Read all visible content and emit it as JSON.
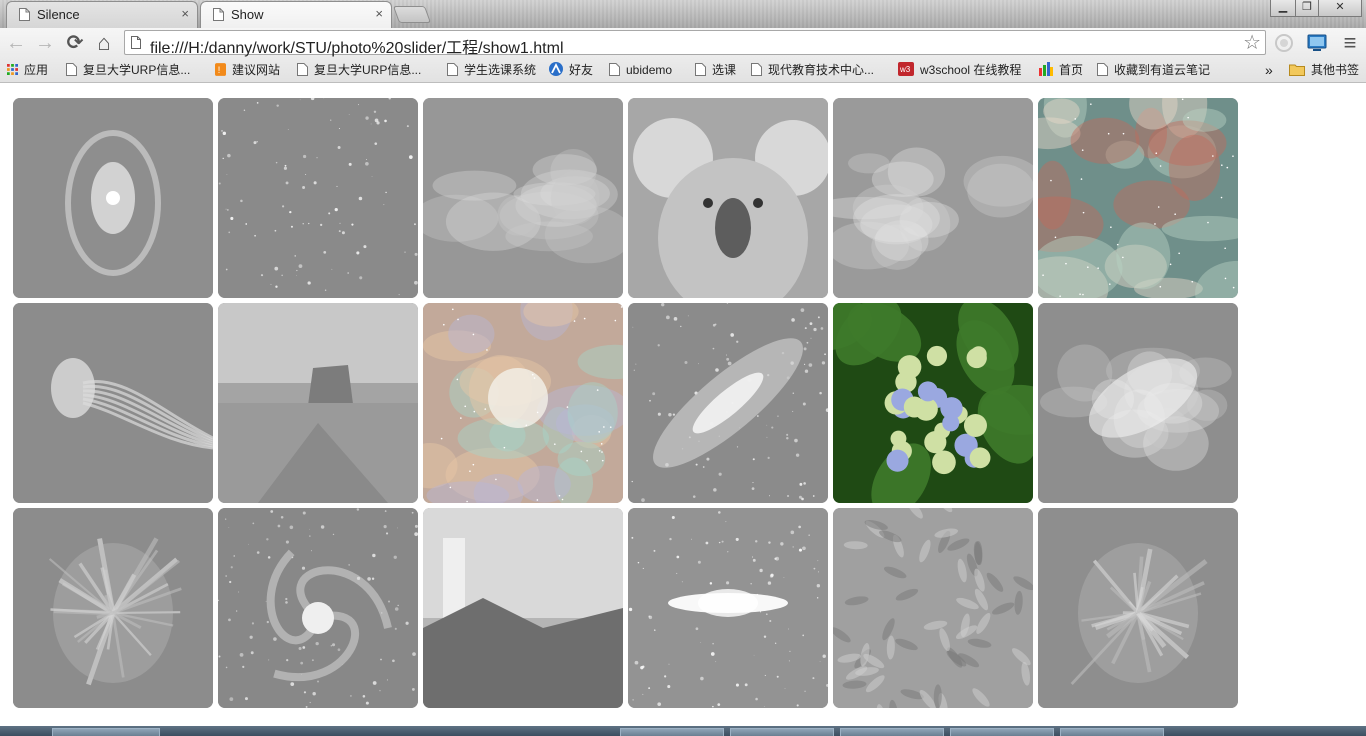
{
  "tabs": [
    {
      "title": "Silence",
      "close": "×",
      "active": false
    },
    {
      "title": "Show",
      "close": "×",
      "active": true
    }
  ],
  "window_controls": {
    "minimize": "▁",
    "restore": "❐",
    "close": "✕"
  },
  "toolbar": {
    "back_icon": "←",
    "forward_icon": "→",
    "reload_icon": "⟳",
    "home_icon": "⌂",
    "url": "file:///H:/danny/work/STU/photo%20slider/工程/show1.html",
    "star_icon": "☆",
    "menu_icon": "≡"
  },
  "bookmarks": [
    {
      "label": "应用",
      "icon": "apps-icon"
    },
    {
      "label": "复旦大学URP信息...",
      "icon": "page-icon"
    },
    {
      "label": "建议网站",
      "icon": "orange-ie-icon"
    },
    {
      "label": "复旦大学URP信息...",
      "icon": "page-icon"
    },
    {
      "label": "学生选课系统",
      "icon": "page-icon"
    },
    {
      "label": "好友",
      "icon": "renren-icon"
    },
    {
      "label": "ubidemo",
      "icon": "page-icon"
    },
    {
      "label": "选课",
      "icon": "page-icon"
    },
    {
      "label": "现代教育技术中心...",
      "icon": "page-icon"
    },
    {
      "label": "w3school 在线教程",
      "icon": "w3-icon"
    },
    {
      "label": "首页",
      "icon": "colored-icon"
    },
    {
      "label": "收藏到有道云笔记",
      "icon": "page-icon"
    }
  ],
  "bookmarks_overflow": "»",
  "other_bookmarks": "其他书签",
  "gallery": [
    {
      "subject": "cat's eye nebula",
      "color": false
    },
    {
      "subject": "deep star field",
      "color": false
    },
    {
      "subject": "milky way region",
      "color": false
    },
    {
      "subject": "koala",
      "color": false
    },
    {
      "subject": "galactic center",
      "color": false
    },
    {
      "subject": "colorful nebula",
      "color": true
    },
    {
      "subject": "jellyfish",
      "color": false
    },
    {
      "subject": "desert butte",
      "color": false
    },
    {
      "subject": "orion nebula",
      "color": true
    },
    {
      "subject": "andromeda galaxy",
      "color": false
    },
    {
      "subject": "hydrangea flower",
      "color": true
    },
    {
      "subject": "crab-like nebula",
      "color": false
    },
    {
      "subject": "crab nebula",
      "color": false
    },
    {
      "subject": "spiral galaxy",
      "color": false
    },
    {
      "subject": "lighthouse",
      "color": false
    },
    {
      "subject": "sombrero galaxy",
      "color": false
    },
    {
      "subject": "chrysanthemum",
      "color": false
    },
    {
      "subject": "supernova remnant",
      "color": false
    }
  ]
}
